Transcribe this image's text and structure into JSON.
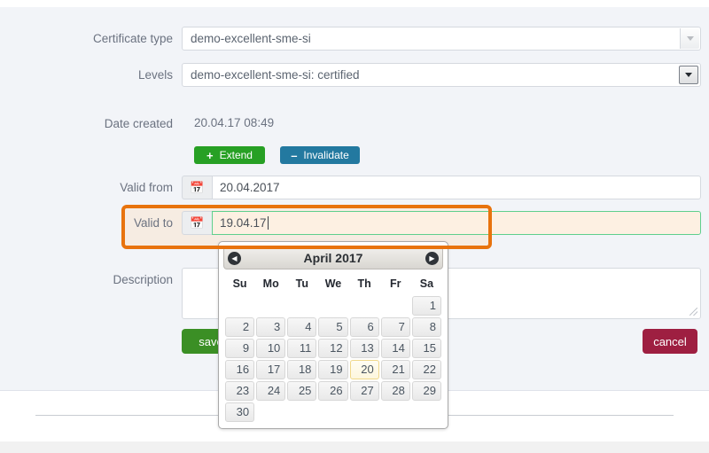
{
  "form": {
    "fields": [
      {
        "label": "Certificate type",
        "value": "demo-excellent-sme-si"
      },
      {
        "label": "Levels",
        "value": "demo-excellent-sme-si: certified"
      }
    ],
    "date_created": {
      "label": "Date created",
      "value": "20.04.17 08:49"
    },
    "buttons": {
      "extend": {
        "label": "Extend",
        "sign": "+",
        "color": "#27a024"
      },
      "invalidate": {
        "label": "Invalidate",
        "sign": "–",
        "color": "#2379a0"
      }
    },
    "valid_from": {
      "label": "Valid from",
      "value": "20.04.2017",
      "icon": "calendar-icon"
    },
    "valid_to": {
      "label": "Valid to",
      "value": "19.04.17",
      "icon": "calendar-icon"
    },
    "description": {
      "label": "Description",
      "value": ""
    },
    "actions": {
      "save": {
        "label": "save",
        "color": "#3b8f25"
      },
      "cancel": {
        "label": "cancel",
        "color": "#9e1f41"
      }
    }
  },
  "datepicker": {
    "title": "April 2017",
    "prev_icon": "chevron-left-icon",
    "next_icon": "chevron-right-icon",
    "weekdays": [
      "Su",
      "Mo",
      "Tu",
      "We",
      "Th",
      "Fr",
      "Sa"
    ],
    "weeks": [
      [
        "",
        "",
        "",
        "",
        "",
        "",
        "1"
      ],
      [
        "2",
        "3",
        "4",
        "5",
        "6",
        "7",
        "8"
      ],
      [
        "9",
        "10",
        "11",
        "12",
        "13",
        "14",
        "15"
      ],
      [
        "16",
        "17",
        "18",
        "19",
        "20",
        "21",
        "22"
      ],
      [
        "23",
        "24",
        "25",
        "26",
        "27",
        "28",
        "29"
      ],
      [
        "30",
        "",
        "",
        "",
        "",
        "",
        ""
      ]
    ],
    "today": "20",
    "today_highlight_color": "#f0d88a"
  },
  "annotation": {
    "color": "#e8730d",
    "target": "valid-to-row"
  },
  "colors": {
    "panel_background": "#f2f4f8",
    "focus_border": "#5fcf8d",
    "focus_background": "#fdf0e2"
  }
}
